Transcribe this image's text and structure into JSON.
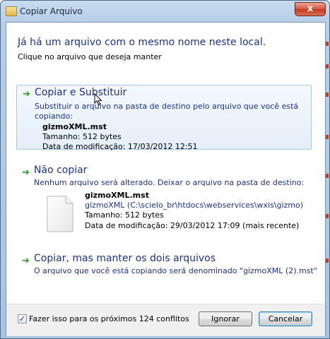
{
  "window": {
    "title": "Copiar Arquivo",
    "close_label": "x"
  },
  "header": {
    "title": "Já há um arquivo com o mesmo nome neste local.",
    "subtitle": "Clique no arquivo que deseja manter"
  },
  "options": {
    "replace": {
      "title": "Copiar e Substituir",
      "desc_line1": "Substituir o arquivo na pasta de destino pelo arquivo que você está",
      "desc_line2": "copiando:",
      "file_name": "gizmoXML.mst",
      "size": "Tamanho: 512 bytes",
      "modified": "Data de modificação: 17/03/2012 12:51"
    },
    "skip": {
      "title": "Não copiar",
      "desc": "Nenhum arquivo será alterado. Deixar o arquivo na pasta de destino:",
      "file_name": "gizmoXML.mst",
      "path": "gizmoXML (C:\\scielo_br\\htdocs\\webservices\\wxis\\gizmo)",
      "size": "Tamanho: 512 bytes",
      "modified": "Data de modificação: 29/03/2012 17:09 (mais recente)"
    },
    "keep_both": {
      "title": "Copiar, mas manter os dois arquivos",
      "desc": "O arquivo que você está copiando será denominado \"gizmoXML (2).mst\""
    }
  },
  "footer": {
    "checkbox_checked": true,
    "checkbox_mark": "✓",
    "checkbox_label": "Fazer isso para os próximos 124 conflitos",
    "ignore_label": "Ignorar",
    "cancel_label": "Cancelar"
  },
  "icons": {
    "arrow": "➔"
  },
  "colors": {
    "link_blue": "#1e3287",
    "arrow_green": "#2d9a1f",
    "highlight_bg": "#e4eef9"
  }
}
